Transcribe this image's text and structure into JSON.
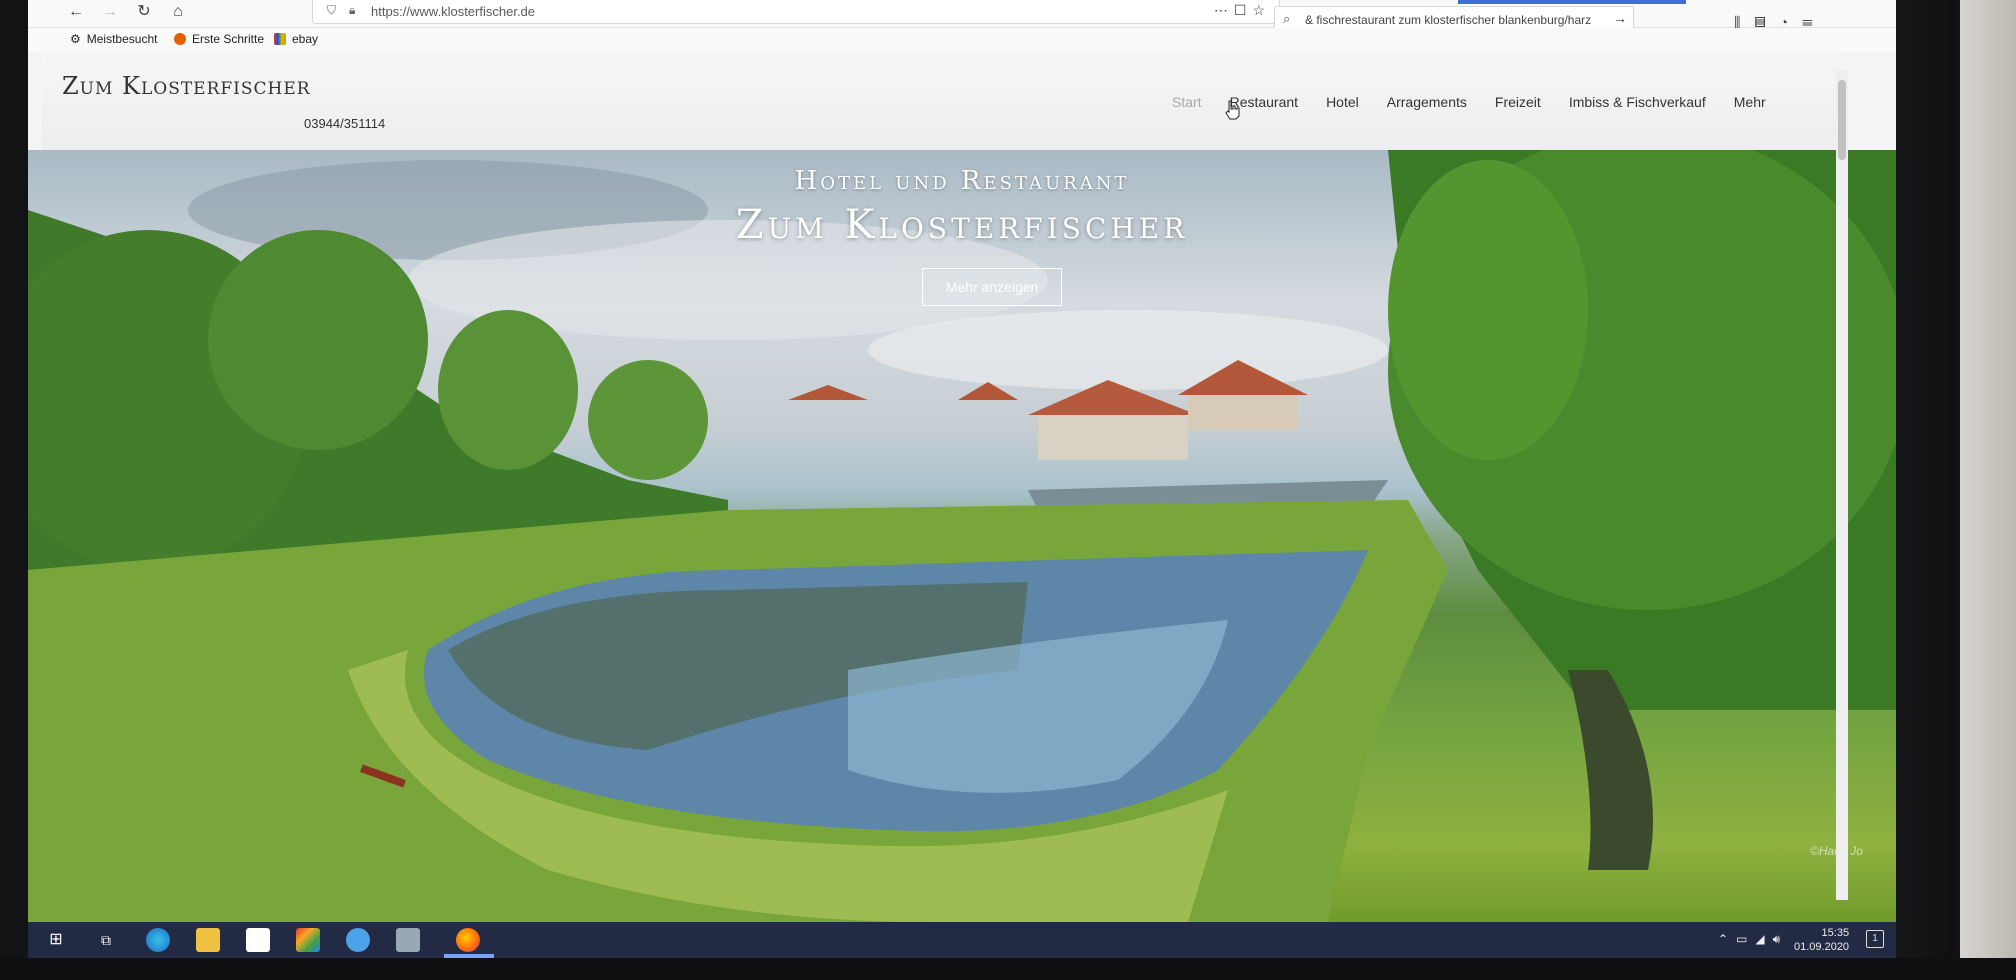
{
  "browser": {
    "url": "https://www.klosterfischer.de",
    "search_text": "& fischrestaurant zum klosterfischer blankenburg/harz",
    "bookmarks": [
      "Meistbesucht",
      "Erste Schritte",
      "ebay"
    ]
  },
  "site": {
    "logo": "Zum Klosterfischer",
    "phone": "03944/351114",
    "nav": [
      "Start",
      "Restaurant",
      "Hotel",
      "Arragements",
      "Freizeit",
      "Imbiss & Fischverkauf",
      "Mehr"
    ],
    "active_nav": "Start"
  },
  "hero": {
    "subtitle": "Hotel und Restaurant",
    "title": "Zum Klosterfischer",
    "button": "Mehr anzeigen",
    "watermark": "©Hanz Jo"
  },
  "taskbar": {
    "time": "15:35",
    "date": "01.09.2020",
    "notifications": "1"
  },
  "colors": {
    "taskbar": "#222a44",
    "accent": "#3f6fd6"
  }
}
